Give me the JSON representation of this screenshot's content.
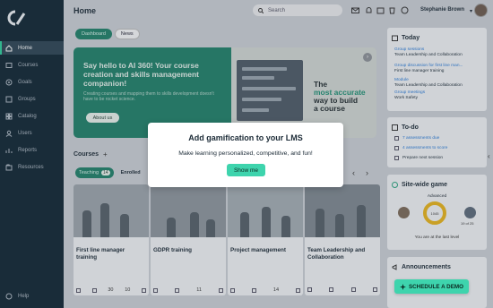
{
  "header": {
    "title": "Home",
    "search_placeholder": "Search",
    "user_name": "Stephanie Brown"
  },
  "sidebar": {
    "items": [
      {
        "label": "Home",
        "icon": "home-icon",
        "active": true
      },
      {
        "label": "Courses",
        "icon": "courses-icon"
      },
      {
        "label": "Goals",
        "icon": "goals-icon"
      },
      {
        "label": "Groups",
        "icon": "groups-icon"
      },
      {
        "label": "Catalog",
        "icon": "catalog-icon"
      },
      {
        "label": "Users",
        "icon": "users-icon"
      },
      {
        "label": "Reports",
        "icon": "reports-icon"
      },
      {
        "label": "Resources",
        "icon": "resources-icon"
      }
    ],
    "help": "Help"
  },
  "tabs": [
    "Dashboard",
    "News"
  ],
  "hero": {
    "title": "Say hello to AI 360! Your course creation and skills management companion!",
    "text": "Creating courses and mapping them to skills development doesn't have to be rocket science.",
    "button": "About us",
    "promo_line1": "The",
    "promo_accent": "most accurate",
    "promo_line3": "way to build",
    "promo_line4": "a course"
  },
  "courses": {
    "heading": "Courses",
    "tab_teaching": "Teaching",
    "teaching_count": "14",
    "tab_enrolled": "Enrolled",
    "cards": [
      {
        "title": "First line manager training",
        "f1": "30",
        "f2": "10"
      },
      {
        "title": "GDPR training",
        "f1": "",
        "f2": "11"
      },
      {
        "title": "Project management",
        "f1": "",
        "f2": "14"
      },
      {
        "title": "Team Leadership and Collaboration",
        "f1": "",
        "f2": ""
      }
    ]
  },
  "today": {
    "title": "Today",
    "items": [
      {
        "link": "Group sessions",
        "sub": "Team Leadership and Collaboration"
      },
      {
        "link": "Group discussion for first line man...",
        "sub": "First line manager training"
      },
      {
        "link": "Module",
        "sub": "Team Leadership and Collaboration"
      },
      {
        "link": "Group meetings",
        "sub": "Work Safety"
      }
    ]
  },
  "todo": {
    "title": "To-do",
    "items": [
      {
        "text": "7 assessments due",
        "link": true
      },
      {
        "text": "4 assessments to score",
        "link": true
      },
      {
        "text": "Prepare next session",
        "link": false
      }
    ]
  },
  "game": {
    "title": "Site-wide game",
    "level": "Advanced",
    "points": "1045",
    "rank": "19 of 25",
    "footer": "You are at the last level"
  },
  "announcements": {
    "title": "Announcements"
  },
  "modal": {
    "title": "Add gamification to your LMS",
    "text": "Make learning personalized, competitive, and fun!",
    "button": "Show me"
  },
  "demo_button": "SCHEDULE A DEMO",
  "colors": {
    "sidebar": "#0f2533",
    "accent": "#1f7f68",
    "cta": "#3ed4ad",
    "link": "#2a7ad6",
    "gauge": "#e6b31b"
  }
}
